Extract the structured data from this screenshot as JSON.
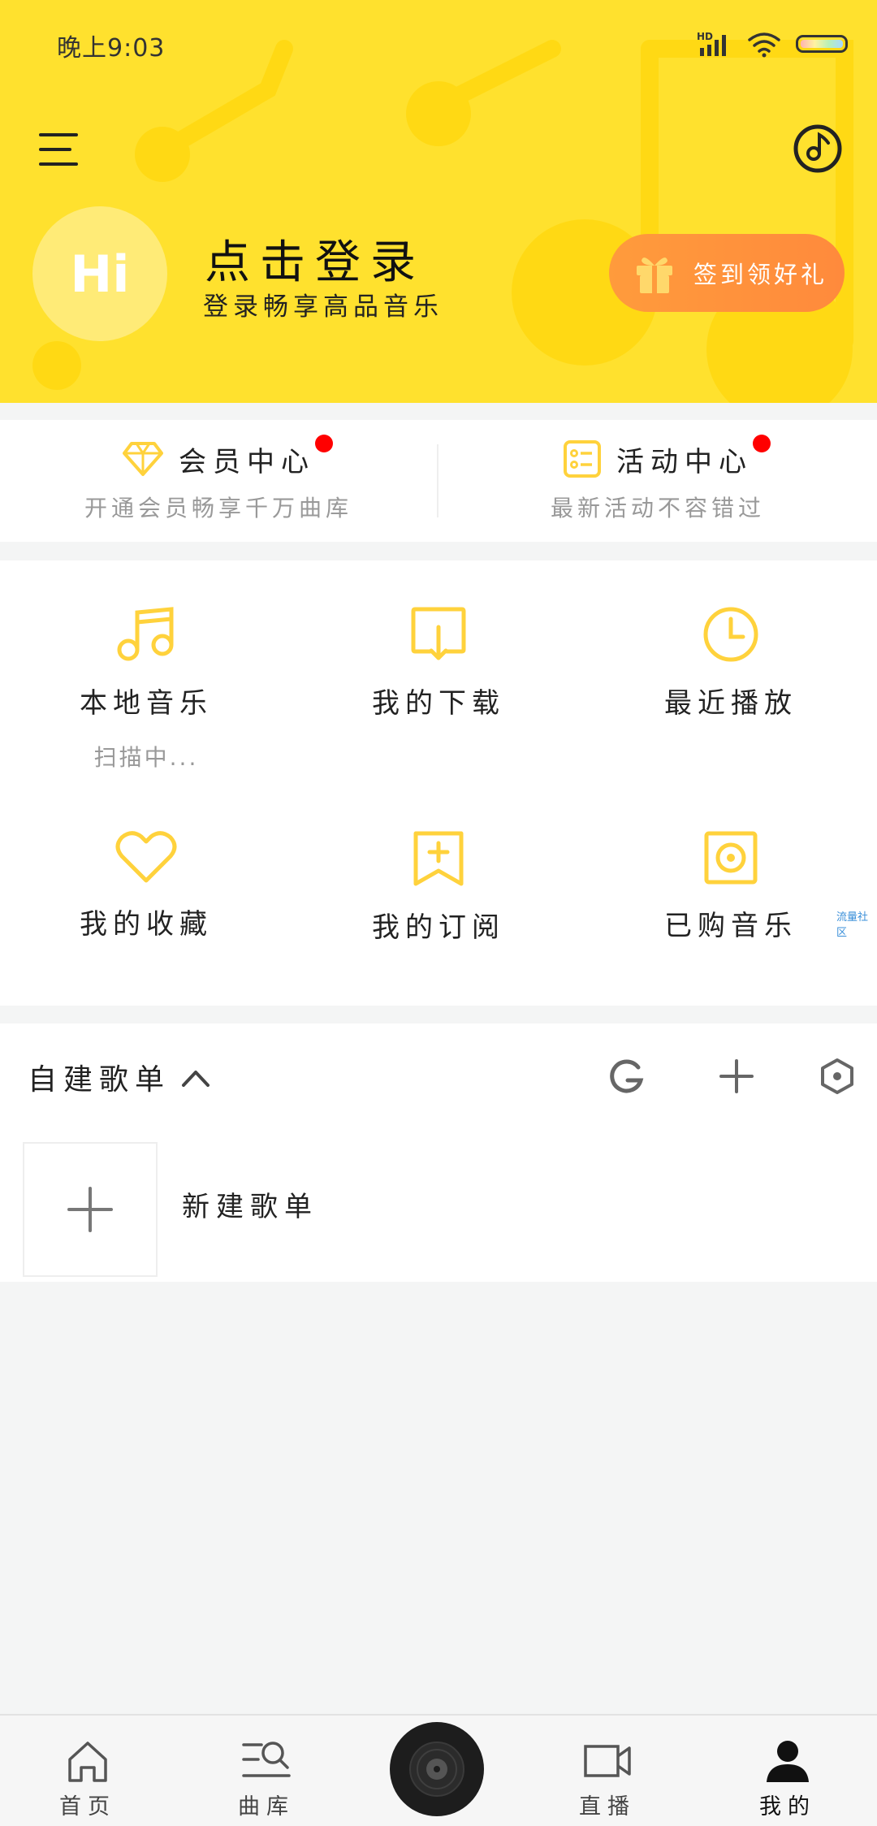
{
  "status_bar": {
    "time": "晚上9:03",
    "network": "HD"
  },
  "header": {
    "avatar_text": "Hi",
    "login_title": "点击登录",
    "login_subtitle": "登录畅享高品音乐",
    "checkin_label": "签到领好礼",
    "icons": [
      "menu-icon",
      "music-disc-icon",
      "gift-icon"
    ]
  },
  "vip": {
    "left": {
      "title": "会员中心",
      "subtitle": "开通会员畅享千万曲库",
      "icon": "diamond-icon"
    },
    "right": {
      "title": "活动中心",
      "subtitle": "最新活动不容错过",
      "icon": "activity-list-icon"
    }
  },
  "grid": {
    "items": [
      {
        "label": "本地音乐",
        "sub": "扫描中...",
        "icon": "music-note-icon"
      },
      {
        "label": "我的下载",
        "icon": "download-icon"
      },
      {
        "label": "最近播放",
        "icon": "clock-icon"
      },
      {
        "label": "我的收藏",
        "icon": "heart-icon"
      },
      {
        "label": "我的订阅",
        "icon": "subscribe-icon"
      },
      {
        "label": "已购音乐",
        "icon": "purchased-icon"
      }
    ],
    "side_tag": "流量社区"
  },
  "playlist": {
    "title": "自建歌单",
    "new_label": "新建歌单",
    "tools": [
      "refresh-icon",
      "plus-icon",
      "settings-icon"
    ]
  },
  "bottom_nav": {
    "items": [
      {
        "label": "首页",
        "icon": "home-icon"
      },
      {
        "label": "曲库",
        "icon": "library-search-icon"
      },
      {
        "label": "直播",
        "icon": "video-camera-icon"
      },
      {
        "label": "我的",
        "icon": "user-icon"
      }
    ]
  },
  "colors": {
    "header_bg": "#ffe12e",
    "accent_yellow": "#ffd23c",
    "checkin_orange": "#ff9340",
    "dot_red": "#ff0000"
  }
}
